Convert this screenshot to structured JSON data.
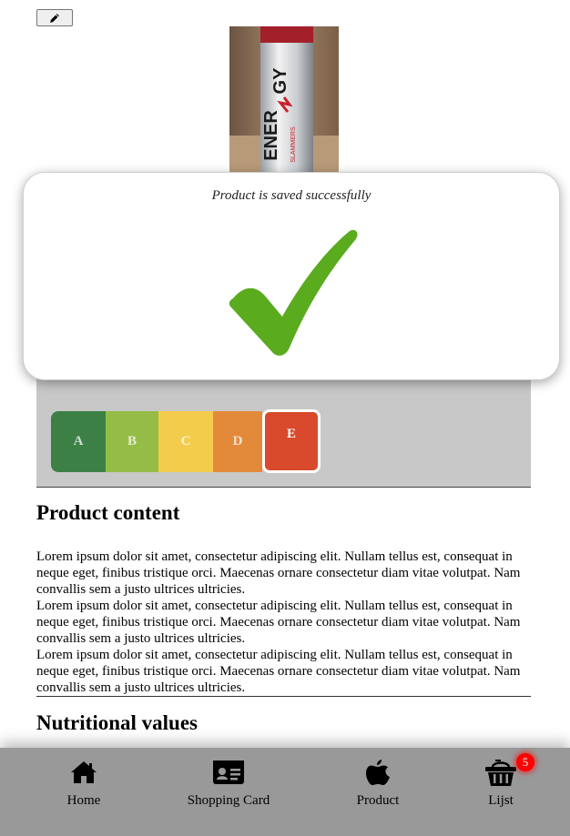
{
  "toast": {
    "message": "Product is saved successfully",
    "icon": "checkmark-icon",
    "color": "#5aab1e"
  },
  "product": {
    "photo_icon": "product-photo"
  },
  "nutriscore": {
    "grades": [
      "A",
      "B",
      "C",
      "D",
      "E"
    ],
    "selected": "E",
    "colors": [
      "#3c8046",
      "#95bc46",
      "#f4cc4c",
      "#e38a3a",
      "#d84a2b"
    ]
  },
  "content": {
    "title": "Product content",
    "paragraphs": [
      "Lorem ipsum dolor sit amet, consectetur adipiscing elit. Nullam tellus est, consequat in neque eget, finibus tristique orci. Maecenas ornare consectetur diam vitae volutpat. Nam convallis sem a justo ultrices ultricies.",
      "Lorem ipsum dolor sit amet, consectetur adipiscing elit. Nullam tellus est, consequat in neque eget, finibus tristique orci. Maecenas ornare consectetur diam vitae volutpat. Nam convallis sem a justo ultrices ultricies.",
      "Lorem ipsum dolor sit amet, consectetur adipiscing elit. Nullam tellus est, consequat in neque eget, finibus tristique orci. Maecenas ornare consectetur diam vitae volutpat. Nam convallis sem a justo ultrices ultricies."
    ]
  },
  "nutrition": {
    "title": "Nutritional values"
  },
  "nav": {
    "home": {
      "label": "Home",
      "icon": "home-icon"
    },
    "card": {
      "label": "Shopping Card",
      "icon": "id-card-icon"
    },
    "product": {
      "label": "Product",
      "icon": "apple-icon"
    },
    "list": {
      "label": "Lijst",
      "icon": "basket-icon",
      "badge": "5"
    }
  }
}
